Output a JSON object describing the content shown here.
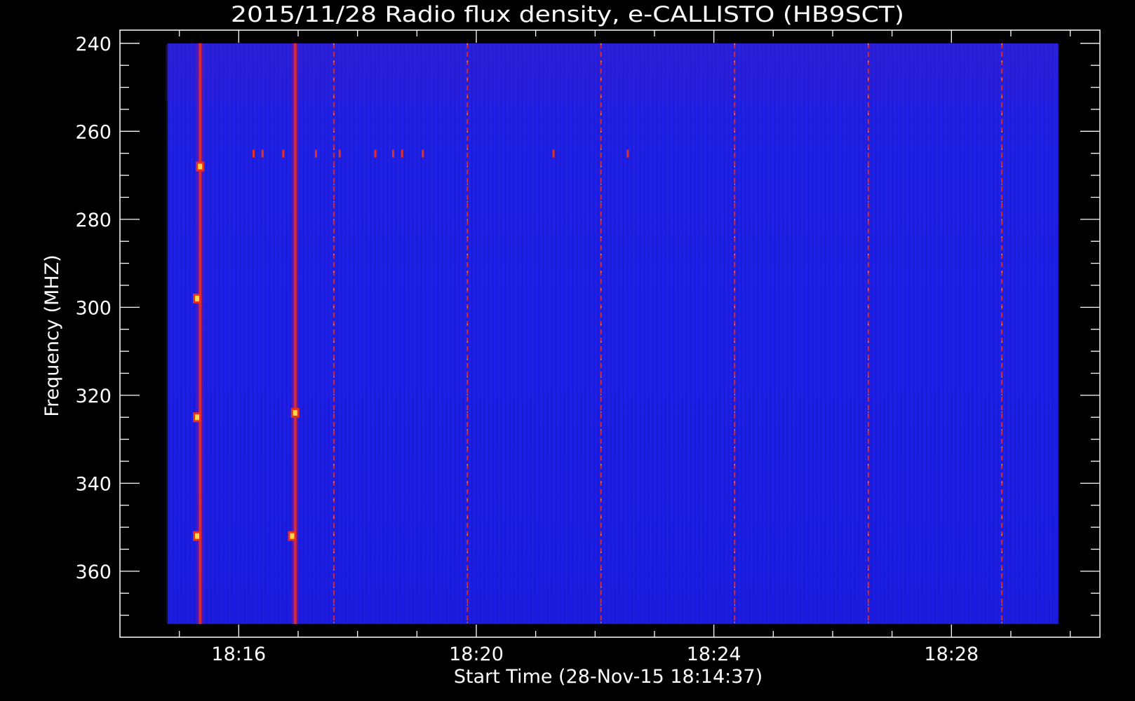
{
  "chart_data": {
    "type": "heatmap",
    "title": "2015/11/28  Radio flux density, e-CALLISTO (HB9SCT)",
    "xlabel": "Start Time (28-Nov-15 18:14:37)",
    "ylabel": "Frequency (MHZ)",
    "x_axis_range_minutes": [
      14.0,
      30.5
    ],
    "data_time_range_minutes": [
      14.8,
      29.8
    ],
    "y_axis_range_mhz": [
      237,
      375
    ],
    "data_freq_range_mhz": [
      240,
      372
    ],
    "y_inverted": true,
    "x_ticks": [
      "18:16",
      "18:20",
      "18:24",
      "18:28"
    ],
    "x_tick_values_minutes": [
      16,
      20,
      24,
      28
    ],
    "y_ticks": [
      "240",
      "260",
      "280",
      "300",
      "320",
      "340",
      "360"
    ],
    "y_tick_values_mhz": [
      240,
      260,
      280,
      300,
      320,
      340,
      360
    ],
    "colormap": {
      "background": "#1e1ee6",
      "low": "#1010c8",
      "mid": "#8a1090",
      "high": "#e83020",
      "peak": "#ffd84a"
    },
    "vertical_bursts": [
      {
        "t": 15.35,
        "intensity": "high"
      },
      {
        "t": 16.95,
        "intensity": "high"
      },
      {
        "t": 17.6,
        "intensity": "medium"
      },
      {
        "t": 19.85,
        "intensity": "medium"
      },
      {
        "t": 22.1,
        "intensity": "medium"
      },
      {
        "t": 24.35,
        "intensity": "medium"
      },
      {
        "t": 26.6,
        "intensity": "medium"
      },
      {
        "t": 28.85,
        "intensity": "medium"
      }
    ],
    "hot_spots": [
      {
        "t": 15.3,
        "f": 325
      },
      {
        "t": 15.3,
        "f": 298
      },
      {
        "t": 15.35,
        "f": 268
      },
      {
        "t": 15.3,
        "f": 352
      },
      {
        "t": 16.95,
        "f": 324
      },
      {
        "t": 16.9,
        "f": 352
      }
    ],
    "narrowband_blips": [
      {
        "t": 16.25,
        "f": 265
      },
      {
        "t": 16.4,
        "f": 265
      },
      {
        "t": 16.75,
        "f": 265
      },
      {
        "t": 17.3,
        "f": 265
      },
      {
        "t": 17.7,
        "f": 265
      },
      {
        "t": 18.3,
        "f": 265
      },
      {
        "t": 18.6,
        "f": 265
      },
      {
        "t": 18.75,
        "f": 265
      },
      {
        "t": 19.1,
        "f": 265
      },
      {
        "t": 21.3,
        "f": 265
      },
      {
        "t": 22.55,
        "f": 265
      }
    ]
  }
}
